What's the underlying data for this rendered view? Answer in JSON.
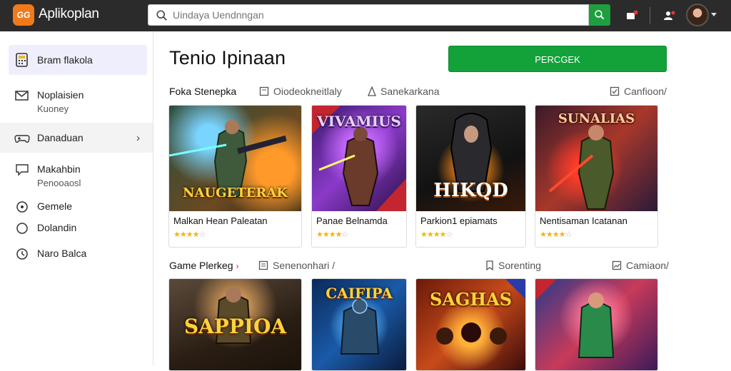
{
  "header": {
    "logo_badge": "GG",
    "app_name": "Aplikoplan",
    "search_placeholder": "Uindaya Uendnngan",
    "colors": {
      "bar": "#2b2b2b",
      "accent": "#1e9e3e",
      "logo": "#f07a1a"
    }
  },
  "sidebar": {
    "items": [
      {
        "label": "Bram flakola",
        "sub": "",
        "icon": "calculator-icon"
      },
      {
        "label": "Noplaisien",
        "sub": "Kuoney",
        "icon": "mail-icon"
      },
      {
        "label": "Danaduan",
        "sub": "",
        "icon": "gamepad-icon",
        "chevron": "›"
      },
      {
        "label": "Makahbin",
        "sub": "Penooaosl",
        "icon": "chat-icon"
      },
      {
        "label": "Gemele",
        "sub": "",
        "icon": "circle-icon"
      },
      {
        "label": "Dolandin",
        "sub": "",
        "icon": "circle-icon"
      },
      {
        "label": "Naro Balca",
        "sub": "",
        "icon": "clock-icon"
      }
    ]
  },
  "main": {
    "title": "Tenio Ipinaan",
    "primary_button": "PERCGEK",
    "sections": [
      {
        "title": "Foka Stenepka",
        "chevron": "",
        "options": [
          "Oiodeokneitlaly",
          "Sanekarkana",
          "Canfioon/"
        ],
        "cards": [
          {
            "title": "Malkan Hean Paleatan",
            "art_text": "NAUGETERAK",
            "rating": 4
          },
          {
            "title": "Panae Belnamda",
            "art_text": "VIVAMIUS",
            "rating": 4
          },
          {
            "title": "Parkion1 epiamats",
            "art_text": "HIKQD",
            "rating": 4
          },
          {
            "title": "Nentisaman Icatanan",
            "art_text": "SUNALIAS",
            "rating": 4
          }
        ]
      },
      {
        "title": "Game Plerkeg",
        "chevron": "›",
        "options": [
          "Senenonhari /",
          "Sorenting",
          "Camiaon/"
        ],
        "cards": [
          {
            "title": "",
            "art_text": "SAPPIOA",
            "rating": 0
          },
          {
            "title": "",
            "art_text": "CAIFIPA",
            "rating": 0
          },
          {
            "title": "",
            "art_text": "SAGHAS",
            "rating": 0
          },
          {
            "title": "",
            "art_text": "",
            "rating": 0
          }
        ]
      }
    ]
  }
}
